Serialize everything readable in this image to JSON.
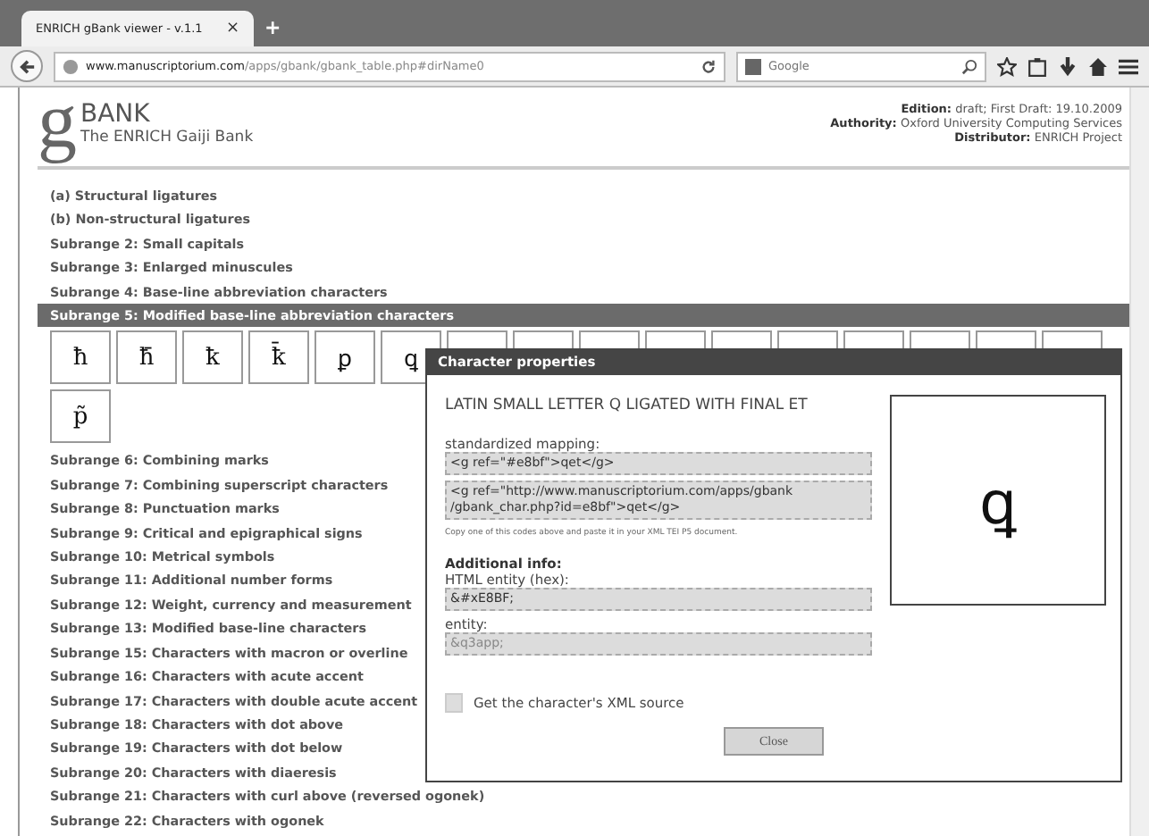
{
  "browser": {
    "tab_title": "ENRICH gBank viewer - v.1.1",
    "tab_close": "×",
    "new_tab": "+",
    "url_host": "www.manuscriptorium.com",
    "url_path": "/apps/gbank/gbank_table.php#dirName0",
    "search_placeholder": "Google"
  },
  "header": {
    "logo_letter": "g",
    "logo_title": "BANK",
    "logo_subtitle": "The ENRICH Gaiji Bank",
    "meta": [
      {
        "label": "Edition:",
        "value": "draft; First Draft: 19.10.2009"
      },
      {
        "label": "Authority:",
        "value": "Oxford University Computing Services"
      },
      {
        "label": "Distributor:",
        "value": "ENRICH Project"
      }
    ]
  },
  "sections_before": [
    {
      "label": "(a) Structural ligatures",
      "selected": false
    },
    {
      "label": "(b) Non-structural ligatures",
      "selected": false
    },
    {
      "label": "Subrange 2: Small capitals",
      "selected": false
    },
    {
      "label": "Subrange 3: Enlarged minuscules",
      "selected": false
    },
    {
      "label": "Subrange 4: Base-line abbreviation characters",
      "selected": false
    },
    {
      "label": "Subrange 5: Modified base-line abbreviation characters",
      "selected": true
    }
  ],
  "characters": [
    {
      "kind": "glyph",
      "glyph": "ħ"
    },
    {
      "kind": "glyph",
      "glyph": "ħ̄"
    },
    {
      "kind": "glyph",
      "glyph": "ꝁ"
    },
    {
      "kind": "glyph",
      "glyph": "ꝁ̄"
    },
    {
      "kind": "glyph",
      "glyph": "ꝑ"
    },
    {
      "kind": "glyph",
      "glyph": "ꝗ"
    },
    {
      "kind": "covered"
    },
    {
      "kind": "covered"
    },
    {
      "kind": "covered"
    },
    {
      "kind": "covered"
    },
    {
      "kind": "covered"
    },
    {
      "kind": "covered"
    },
    {
      "kind": "covered"
    },
    {
      "kind": "covered"
    },
    {
      "kind": "covered"
    },
    {
      "kind": "covered"
    },
    {
      "kind": "glyph",
      "glyph": "p̃"
    }
  ],
  "sections_after": [
    {
      "label": "Subrange 6: Combining marks",
      "selected": false
    },
    {
      "label": "Subrange 7: Combining superscript characters",
      "selected": false
    },
    {
      "label": "Subrange 8: Punctuation marks",
      "selected": false
    },
    {
      "label": "Subrange 9: Critical and epigraphical signs",
      "selected": false
    },
    {
      "label": "Subrange 10: Metrical symbols",
      "selected": false
    },
    {
      "label": "Subrange 11: Additional number forms",
      "selected": false
    },
    {
      "label": "Subrange 12: Weight, currency and measurement",
      "selected": false
    },
    {
      "label": "Subrange 13: Modified base-line characters",
      "selected": false
    },
    {
      "label": "Subrange 15: Characters with macron or overline",
      "selected": false
    },
    {
      "label": "Subrange 16: Characters with acute accent",
      "selected": false
    },
    {
      "label": "Subrange 17: Characters with double acute accent",
      "selected": false
    },
    {
      "label": "Subrange 18: Characters with dot above",
      "selected": false
    },
    {
      "label": "Subrange 19: Characters with dot below",
      "selected": false
    },
    {
      "label": "Subrange 20: Characters with diaeresis",
      "selected": false
    },
    {
      "label": "Subrange 21: Characters with curl above (reversed ogonek)",
      "selected": false
    },
    {
      "label": "Subrange 22: Characters with ogonek",
      "selected": false
    }
  ],
  "dialog": {
    "title": "Character properties",
    "char_name": "LATIN SMALL LETTER Q LIGATED WITH FINAL ET",
    "preview_glyph": "ꝗ",
    "mapping_label": "standardized mapping:",
    "mapping_short": "<g ref=\"#e8bf\">qet</g>",
    "mapping_long": "<g ref=\"http://www.manuscriptorium.com/apps/gbank /gbank_char.php?id=e8bf\">qet</g>",
    "copy_hint": "Copy one of this codes above and paste it in your XML TEI P5 document.",
    "info_heading": "Additional info:",
    "hex_label": "HTML entity (hex):",
    "hex_value": "&#xE8BF;",
    "entity_label": "entity:",
    "entity_value": "&q3app;",
    "xml_source": "Get the character's XML source",
    "close": "Close"
  }
}
